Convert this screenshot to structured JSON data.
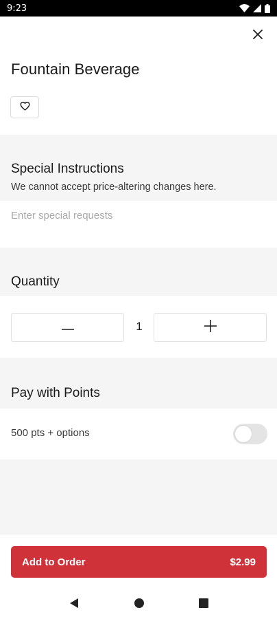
{
  "status_bar": {
    "time": "9:23"
  },
  "item": {
    "title": "Fountain Beverage"
  },
  "special_instructions": {
    "heading": "Special Instructions",
    "subtitle": "We cannot accept price-altering changes here.",
    "placeholder": "Enter special requests",
    "value": ""
  },
  "quantity": {
    "heading": "Quantity",
    "value": "1"
  },
  "points": {
    "heading": "Pay with Points",
    "label": "500 pts + options",
    "enabled": false
  },
  "order_button": {
    "label": "Add to Order",
    "price": "$2.99"
  },
  "colors": {
    "accent": "#d0323a",
    "background": "#f5f5f5"
  },
  "icons": [
    "close-icon",
    "heart-icon",
    "minus-icon",
    "plus-icon",
    "back-icon",
    "home-icon",
    "recents-icon",
    "wifi-icon",
    "signal-icon",
    "battery-icon"
  ]
}
